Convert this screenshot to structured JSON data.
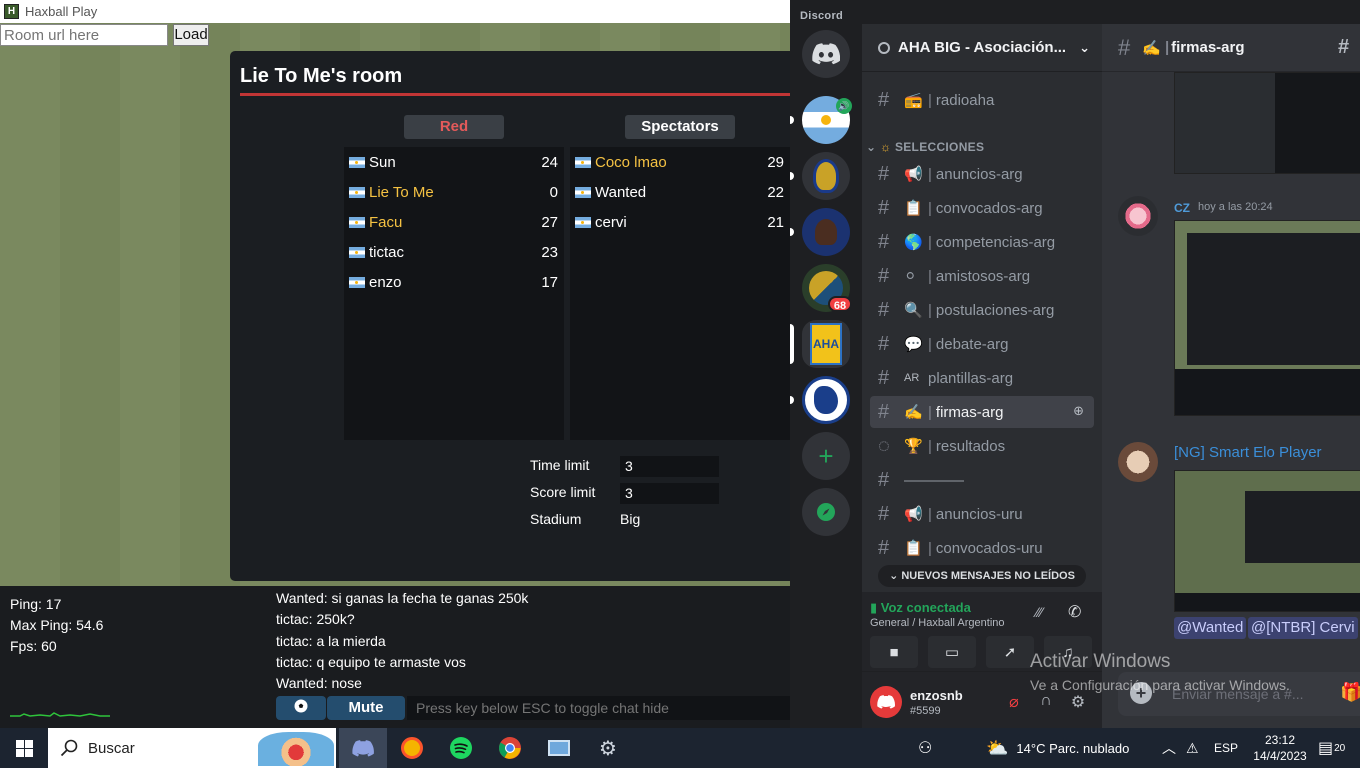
{
  "haxball": {
    "window_title": "Haxball Play",
    "room_url_placeholder": "Room url here",
    "load_label": "Load",
    "room": {
      "title": "Lie To Me's room",
      "red_label": "Red",
      "spectators_label": "Spectators",
      "red_players": [
        {
          "name": "Sun",
          "ping": "24",
          "admin": false
        },
        {
          "name": "Lie To Me",
          "ping": "0",
          "admin": true
        },
        {
          "name": "Facu",
          "ping": "27",
          "admin": true
        },
        {
          "name": "tictac",
          "ping": "23",
          "admin": false
        },
        {
          "name": "enzo",
          "ping": "17",
          "admin": false
        }
      ],
      "spectators": [
        {
          "name": "Coco lmao",
          "ping": "29",
          "admin": true
        },
        {
          "name": "Wanted",
          "ping": "22",
          "admin": false
        },
        {
          "name": "cervi",
          "ping": "21",
          "admin": false
        }
      ],
      "settings": {
        "time_limit_label": "Time limit",
        "time_limit": "3",
        "score_limit_label": "Score limit",
        "score_limit": "3",
        "stadium_label": "Stadium",
        "stadium": "Big"
      }
    },
    "stats": {
      "ping": "Ping: 17",
      "max_ping": "Max Ping: 54.6",
      "fps": "Fps: 60"
    },
    "chat": [
      "Wanted: si ganas la fecha te ganas 250k",
      "tictac: 250k?",
      "tictac: a la mierda",
      "tictac: q equipo te armaste vos",
      "Wanted: nose"
    ],
    "mute_label": "Mute",
    "chat_placeholder": "Press key below ESC to toggle chat hide"
  },
  "discord": {
    "brand": "Discord",
    "server_name": "AHA BIG - Asociación...",
    "guild_badge": "68",
    "category": "SELECCIONES",
    "channels_top": [
      {
        "emoji": "📻",
        "name": "radioaha"
      }
    ],
    "channels": [
      {
        "emoji": "📢",
        "name": "anuncios-arg"
      },
      {
        "emoji": "📋",
        "name": "convocados-arg"
      },
      {
        "emoji": "🌎",
        "name": "competencias-arg"
      },
      {
        "emoji": "⚪",
        "name": "amistosos-arg"
      },
      {
        "emoji": "🔍",
        "name": "postulaciones-arg"
      },
      {
        "emoji": "💬",
        "name": "debate-arg"
      },
      {
        "emoji": "AR",
        "name": "plantillas-arg"
      },
      {
        "emoji": "✍️",
        "name": "firmas-arg"
      },
      {
        "emoji": "🏆",
        "name": "resultados"
      },
      {
        "emoji": "",
        "name": "————"
      },
      {
        "emoji": "📢",
        "name": "anuncios-uru"
      },
      {
        "emoji": "📋",
        "name": "convocados-uru"
      }
    ],
    "new_messages": "NUEVOS MENSAJES NO LEÍDOS",
    "voice_status": "Voz conectada",
    "voice_channel": "General / Haxball Argentino",
    "username": "enzosnb",
    "user_tag": "#5599",
    "current_channel": "firmas-arg",
    "messages": [
      {
        "author": "CZ",
        "time": "hoy a las 20:24",
        "color": "#4f9bd9"
      },
      {
        "author": "[NG] Smart Elo Player",
        "time": "",
        "color": "#3b8fd9"
      }
    ],
    "mentions": [
      "@Wanted",
      "@[NTBR] Cervi"
    ],
    "composer_placeholder": "Enviar mensaje a #..."
  },
  "windows_activation": {
    "title": "Activar Windows",
    "subtitle": "Ve a Configuración para activar Windows."
  },
  "taskbar": {
    "search_label": "Buscar",
    "weather": "14°C  Parc. nublado",
    "language": "ESP",
    "time": "23:12",
    "date": "14/4/2023",
    "notifications": "20"
  }
}
